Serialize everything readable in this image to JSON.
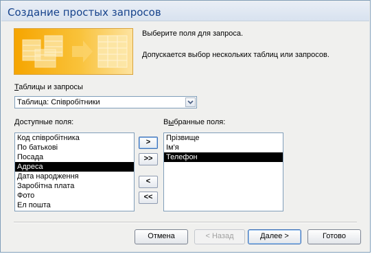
{
  "window": {
    "title": "Создание простых запросов"
  },
  "intro": {
    "line1": "Выберите поля для запроса.",
    "line2": "Допускается выбор нескольких таблиц или запросов."
  },
  "tables": {
    "label_accel": "Т",
    "label_rest": "аблицы и запросы",
    "selected": "Таблица: Співробітники"
  },
  "available": {
    "label_accel": "Д",
    "label_rest": "оступные поля:",
    "items": [
      "Код співробітника",
      "По батькові",
      "Посада",
      "Адреса",
      "Дата народження",
      "Заробітна плата",
      "Фото",
      "Ел пошта"
    ],
    "selected_index": 3
  },
  "selected_fields": {
    "label_pre": "В",
    "label_accel": "ы",
    "label_rest": "бранные поля:",
    "items": [
      "Прізвище",
      "Ім'я",
      "Телефон"
    ],
    "selected_index": 2
  },
  "move_buttons": {
    "add": ">",
    "add_all": ">>",
    "remove": "<",
    "remove_all": "<<"
  },
  "footer": {
    "cancel": "Отмена",
    "back": "< Назад",
    "next_accel": "Д",
    "next_rest": "алее >",
    "finish": "Готово"
  }
}
